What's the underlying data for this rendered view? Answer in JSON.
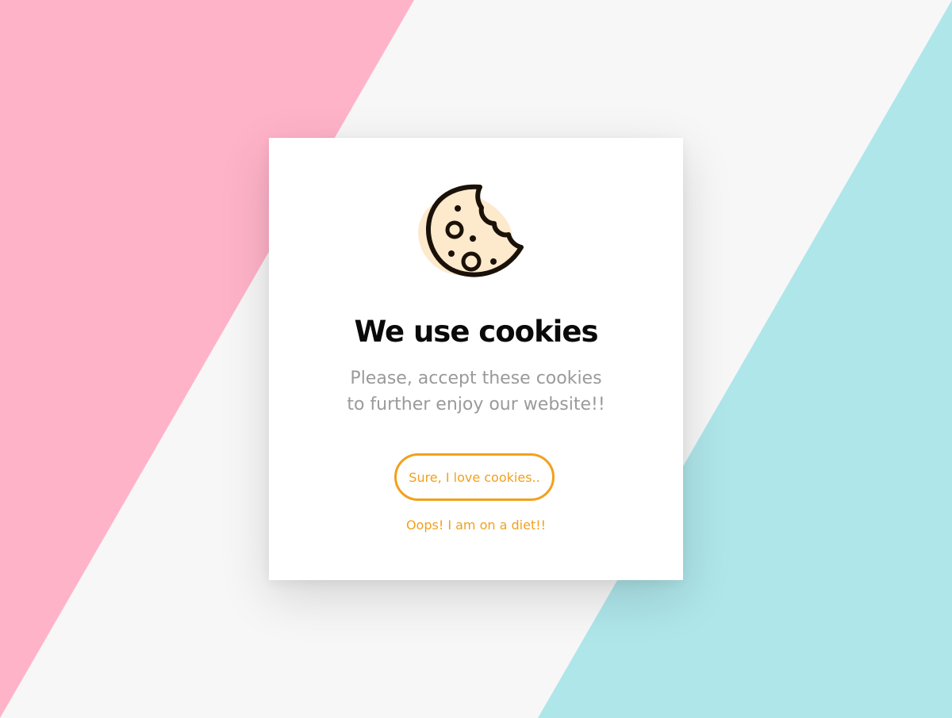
{
  "background": {
    "base_color": "#f7f7f7",
    "left_color": "#ffb3c9",
    "right_color": "#aee6ea"
  },
  "dialog": {
    "icon": "cookie-icon",
    "title": "We use cookies",
    "description_lines": [
      "Please, accept these cookies",
      "to further enjoy our website!!"
    ],
    "accept_label": "Sure, I love cookies..",
    "decline_label": "Oops! I am on a diet!!",
    "accent_color": "#f2a01c"
  }
}
